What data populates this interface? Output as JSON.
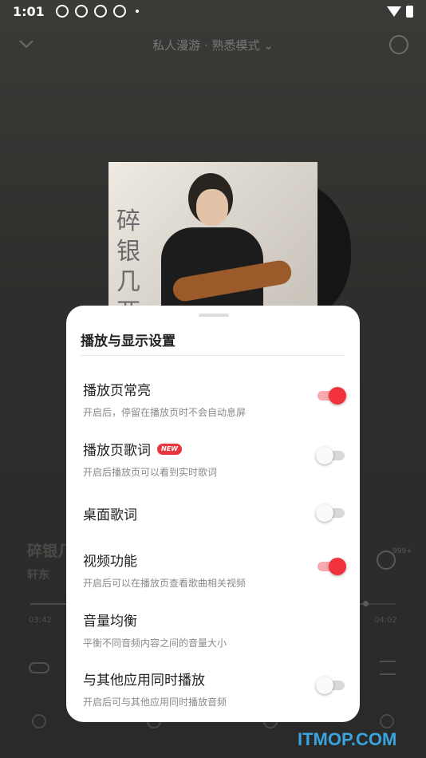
{
  "status_bar": {
    "time": "1:01"
  },
  "player": {
    "header_title": "私人漫游 · 熟悉模式 ⌄",
    "song_title": "碎银几",
    "artist": "轩东",
    "comment_count": "999+",
    "current_time": "03:42",
    "total_time": "04:02",
    "progress": 0.92,
    "cover_calligraphy": "碎银几两"
  },
  "settings_sheet": {
    "title": "播放与显示设置",
    "rows": [
      {
        "label": "播放页常亮",
        "description": "开启后，停留在播放页时不会自动息屏",
        "enabled": true
      },
      {
        "label": "播放页歌词",
        "badge": "NEW",
        "description": "开启后播放页可以看到实时歌词",
        "enabled": false
      },
      {
        "label": "桌面歌词",
        "enabled": false
      },
      {
        "label": "视频功能",
        "description": "开启后可以在播放页查看歌曲相关视频",
        "enabled": true
      },
      {
        "label": "音量均衡",
        "description": "平衡不同音频内容之间的音量大小"
      },
      {
        "label": "与其他应用同时播放",
        "description": "开启后可与其他应用同时播放音频",
        "enabled": false
      }
    ]
  },
  "watermark": "ITMOP.COM",
  "colors": {
    "accent": "#f2323d",
    "accent_track": "#f7a9ae",
    "watermark": "#3aa3e0"
  }
}
